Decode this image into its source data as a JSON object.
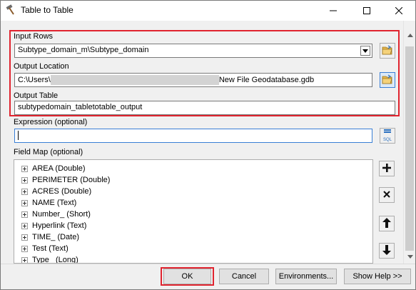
{
  "window": {
    "title": "Table to Table",
    "minimize_icon": "minimize-icon",
    "maximize_icon": "maximize-icon",
    "close_icon": "close-icon"
  },
  "input_rows": {
    "label": "Input Rows",
    "value": "Subtype_domain_m\\Subtype_domain"
  },
  "output_location": {
    "label": "Output Location",
    "value_prefix": "C:\\Users\\",
    "value_suffix": "New File Geodatabase.gdb"
  },
  "output_table": {
    "label": "Output Table",
    "value": "subtypedomain_tabletotable_output"
  },
  "expression": {
    "label": "Expression (optional)",
    "value": "",
    "sql_label": "SQL"
  },
  "field_map": {
    "label": "Field Map (optional)",
    "items": [
      "AREA (Double)",
      "PERIMETER (Double)",
      "ACRES (Double)",
      "NAME (Text)",
      "Number_ (Short)",
      "Hyperlink (Text)",
      "TIME_ (Date)",
      "Test (Text)",
      "Type_ (Long)"
    ]
  },
  "buttons": {
    "ok": "OK",
    "cancel": "Cancel",
    "environments": "Environments...",
    "show_help": "Show Help >>"
  },
  "colors": {
    "highlight": "#e0242f",
    "folder": "#e8b84a"
  }
}
